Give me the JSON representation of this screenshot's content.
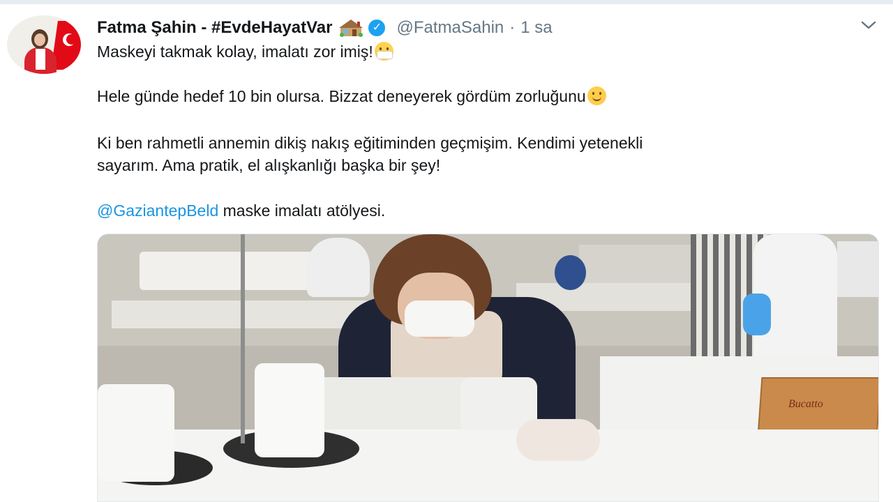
{
  "tweet": {
    "author_name": "Fatma Şahin - #EvdeHayatVar",
    "handle": "@FatmaSahin",
    "separator": "·",
    "time": "1 sa",
    "line1": "Maskeyi takmak kolay, imalatı zor imiş!",
    "line2": "Hele günde hedef 10 bin olursa. Bizzat deneyerek gördüm zorluğunu",
    "line3a": "Ki ben rahmetli annemin dikiş nakış eğitiminden geçmişim. Kendimi yetenekli",
    "line3b": "sayarım. Ama pratik, el alışkanlığı başka bir şey!",
    "mention": "@GaziantepBeld",
    "line4_rest": " maske imalatı atölyesi.",
    "icons": [
      "house-emoji-icon",
      "verified-badge-icon",
      "chevron-down-icon",
      "face-mask-emoji-icon",
      "smiling-face-emoji-icon"
    ],
    "colors": {
      "link": "#1b95e0",
      "verified": "#1da1f2",
      "secondary_text": "#657786"
    }
  },
  "media": {
    "box_label": "Bucatto"
  }
}
